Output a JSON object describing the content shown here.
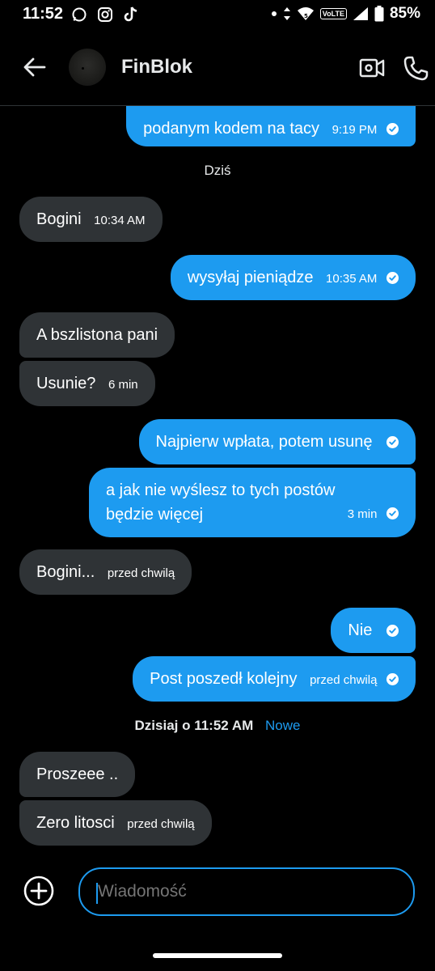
{
  "status_bar": {
    "time": "11:52",
    "battery": "85%",
    "volte": "VoLTE",
    "icons": [
      "whatsapp-icon",
      "instagram-icon",
      "tiktok-icon",
      "dot-icon",
      "data-arrows-icon",
      "wifi-icon",
      "signal-icon",
      "battery-icon"
    ]
  },
  "header": {
    "title": "FinBlok",
    "back_icon": "arrow-left-icon",
    "video_icon": "video-call-icon",
    "phone_icon": "phone-icon"
  },
  "messages": [
    {
      "dir": "out",
      "text": "podanym kodem na tacy",
      "time": "9:19 PM",
      "read": true
    },
    {
      "type": "separator",
      "text": "Dziś"
    },
    {
      "dir": "in",
      "text": "Bogini",
      "time": "10:34 AM"
    },
    {
      "dir": "out",
      "text": "wysyłaj pieniądze",
      "time": "10:35 AM",
      "read": true
    },
    {
      "dir": "in",
      "text": "A bszlistona pani",
      "time": ""
    },
    {
      "dir": "in",
      "text": "Usunie?",
      "time": "6 min"
    },
    {
      "dir": "out",
      "text": "Najpierw wpłata, potem usunę",
      "time": "",
      "read": true
    },
    {
      "dir": "out",
      "text": "a jak nie wyślesz to tych postów będzie więcej",
      "time": "3 min",
      "read": true
    },
    {
      "dir": "in",
      "text": "Bogini...",
      "time": "przed chwilą"
    },
    {
      "dir": "out",
      "text": "Nie",
      "time": "",
      "read": true
    },
    {
      "dir": "out",
      "text": "Post poszedł kolejny",
      "time": "przed chwilą",
      "read": true
    },
    {
      "type": "separator",
      "text": "Dzisiaj o 11:52 AM",
      "badge": "Nowe"
    },
    {
      "dir": "in",
      "text": "Proszeee ..",
      "time": ""
    },
    {
      "dir": "in",
      "text": "Zero litosci",
      "time": "przed chwilą"
    }
  ],
  "composer": {
    "placeholder": "Wiadomość",
    "plus_icon": "plus-circle-icon"
  },
  "colors": {
    "background": "#000000",
    "outgoing_bubble": "#1d9bf0",
    "incoming_bubble": "#2f3336",
    "accent": "#1d9bf0"
  }
}
